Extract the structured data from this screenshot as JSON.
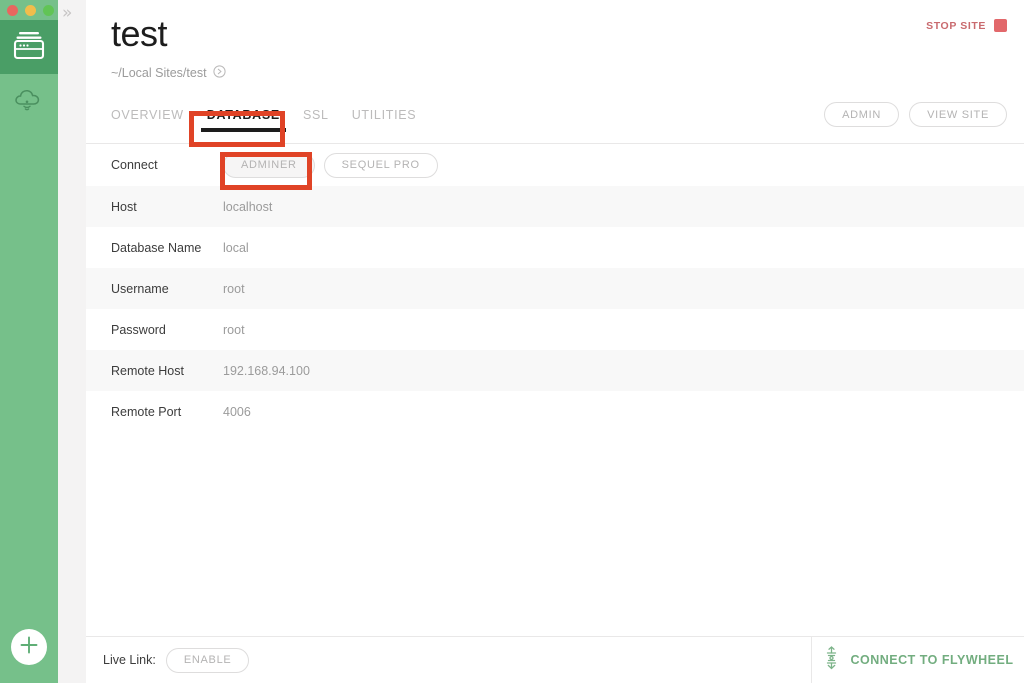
{
  "window": {
    "traffic_lights": [
      "close",
      "minimize",
      "maximize"
    ],
    "expand_icon": "chevron-double-right-icon"
  },
  "sidebar": {
    "items": [
      {
        "name": "sites",
        "icon": "window-stack-icon",
        "active": true
      },
      {
        "name": "cloud",
        "icon": "cloud-download-icon",
        "active": false
      }
    ],
    "add_button": {
      "icon": "plus-icon",
      "label": "+"
    }
  },
  "header": {
    "title": "test",
    "path": "~/Local Sites/test",
    "path_icon": "reveal-in-finder-icon",
    "stop_site_label": "STOP SITE",
    "stop_icon": "stop-square-icon",
    "stop_color": "#e2686b"
  },
  "tabs": [
    {
      "label": "OVERVIEW",
      "active": false
    },
    {
      "label": "DATABASE",
      "active": true
    },
    {
      "label": "SSL",
      "active": false
    },
    {
      "label": "UTILITIES",
      "active": false
    }
  ],
  "top_actions": [
    {
      "label": "ADMIN"
    },
    {
      "label": "VIEW SITE"
    }
  ],
  "connect": {
    "label": "Connect",
    "buttons": [
      {
        "label": "ADMINER",
        "filled": true
      },
      {
        "label": "SEQUEL PRO",
        "filled": false
      }
    ]
  },
  "fields": [
    {
      "key": "Host",
      "value": "localhost"
    },
    {
      "key": "Database Name",
      "value": "local"
    },
    {
      "key": "Username",
      "value": "root"
    },
    {
      "key": "Password",
      "value": "root"
    },
    {
      "key": "Remote Host",
      "value": "192.168.94.100"
    },
    {
      "key": "Remote Port",
      "value": "4006"
    }
  ],
  "footer": {
    "live_link_label": "Live Link:",
    "enable_label": "ENABLE",
    "flywheel_label": "CONNECT TO FLYWHEEL",
    "flywheel_icon": "flywheel-logo-icon",
    "flywheel_color": "#72ad7f"
  },
  "annotations": [
    {
      "name": "database-tab-highlight",
      "color": "#e04326"
    },
    {
      "name": "adminer-button-highlight",
      "color": "#e04326"
    }
  ]
}
